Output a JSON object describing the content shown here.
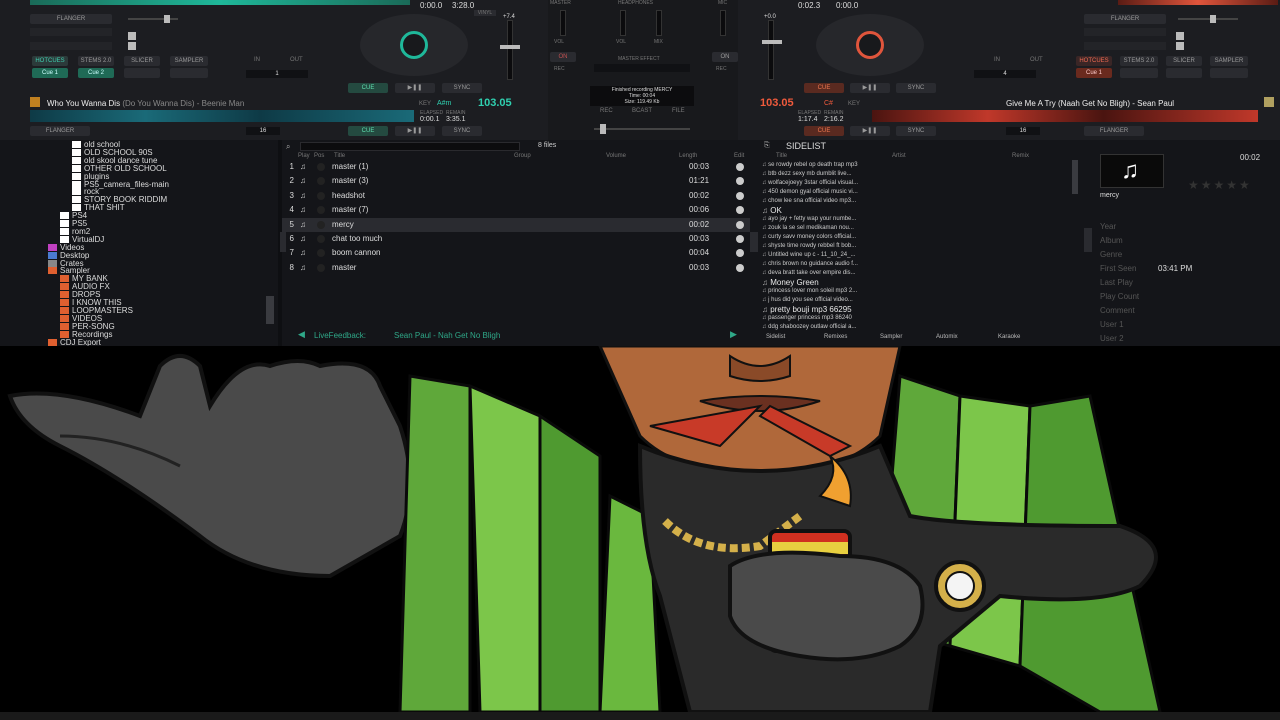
{
  "deck_left": {
    "time_elapsed": "0:00.0",
    "time_remain": "3:28.0",
    "pitch_val": "+7.4",
    "effect": "FLANGER",
    "pad_tabs": [
      "HOTCUES",
      "STEMS 2.0",
      "SLICER",
      "SAMPLER"
    ],
    "cue_labels": [
      "Cue 1",
      "Cue 2"
    ],
    "loop_in": "IN",
    "loop_out": "OUT",
    "loop_size": "1",
    "cue": "CUE",
    "play": "▶❚❚",
    "sync": "SYNC",
    "title": "Who You Wanna Dis",
    "title_sub": "(Do You Wanna Dis) - Beenie Man",
    "key_label": "KEY",
    "key": "A#m",
    "bpm": "103.05",
    "elapsed_label": "ELAPSED",
    "remain_label": "REMAIN",
    "elapsed": "0:00.1",
    "remain": "3:35.1",
    "bottom_effect": "FLANGER",
    "bottom_loop": "16"
  },
  "deck_right": {
    "time_elapsed": "0:02.3",
    "time_remain": "0:00.0",
    "pitch_val": "+0.0",
    "effect": "FLANGER",
    "pad_tabs": [
      "HOTCUES",
      "STEMS 2.0",
      "SLICER",
      "SAMPLER"
    ],
    "cue_labels": [
      "Cue 1"
    ],
    "loop_in": "IN",
    "loop_out": "OUT",
    "loop_size": "4",
    "cue": "CUE",
    "play": "▶❚❚",
    "sync": "SYNC",
    "title": "Give Me A Try (Naah Get No Bligh) - Sean Paul",
    "key_label": "KEY",
    "key": "C#",
    "bpm": "103.05",
    "elapsed_label": "ELAPSED",
    "remain_label": "REMAIN",
    "elapsed": "1:17.4",
    "remain": "2:16.2",
    "bottom_effect": "FLANGER",
    "bottom_loop": "16"
  },
  "mixer": {
    "master": "MASTER",
    "headphones": "HEADPHONES",
    "mic": "MIC",
    "vol": "VOL",
    "mix": "MIX",
    "on": "ON",
    "rec": "REC",
    "master_effect": "MASTER EFFECT",
    "recording_msg": "Finished recording MERCY",
    "rec_time": "Time: 00:04",
    "rec_size": "Size: 119.49 Kb",
    "rec_btn": "REC",
    "bcast_btn": "BCAST",
    "file_btn": "FILE"
  },
  "tree": [
    {
      "label": "old school",
      "indent": 3,
      "color": "#ffffff"
    },
    {
      "label": "OLD SCHOOL 90S",
      "indent": 3,
      "color": "#ffffff"
    },
    {
      "label": "old skool dance tune",
      "indent": 3,
      "color": "#ffffff"
    },
    {
      "label": "OTHER OLD SCHOOL",
      "indent": 3,
      "color": "#ffffff"
    },
    {
      "label": "plugins",
      "indent": 3,
      "color": "#ffffff"
    },
    {
      "label": "PS5_camera_files-main",
      "indent": 3,
      "color": "#ffffff"
    },
    {
      "label": "rock",
      "indent": 3,
      "color": "#ffffff"
    },
    {
      "label": "STORY BOOK RIDDIM",
      "indent": 3,
      "color": "#ffffff"
    },
    {
      "label": "THAT SHIT",
      "indent": 3,
      "color": "#ffffff"
    },
    {
      "label": "PS4",
      "indent": 2,
      "color": "#ffffff"
    },
    {
      "label": "PS5",
      "indent": 2,
      "color": "#ffffff"
    },
    {
      "label": "rom2",
      "indent": 2,
      "color": "#ffffff"
    },
    {
      "label": "VirtualDJ",
      "indent": 2,
      "color": "#ffffff"
    },
    {
      "label": "Videos",
      "indent": 1,
      "color": "#c040c0"
    },
    {
      "label": "Desktop",
      "indent": 1,
      "color": "#4a7ad0"
    },
    {
      "label": "Crates",
      "indent": 1,
      "color": "#888888"
    },
    {
      "label": "Sampler",
      "indent": 1,
      "color": "#e06030"
    },
    {
      "label": "MY BANK",
      "indent": 2,
      "color": "#e06030"
    },
    {
      "label": "AUDIO FX",
      "indent": 2,
      "color": "#e06030"
    },
    {
      "label": "DROPS",
      "indent": 2,
      "color": "#e06030"
    },
    {
      "label": "I KNOW THIS",
      "indent": 2,
      "color": "#e06030"
    },
    {
      "label": "LOOPMASTERS",
      "indent": 2,
      "color": "#e06030"
    },
    {
      "label": "VIDEOS",
      "indent": 2,
      "color": "#e06030"
    },
    {
      "label": "PER-SONG",
      "indent": 2,
      "color": "#e06030"
    },
    {
      "label": "Recordings",
      "indent": 2,
      "color": "#e06030"
    },
    {
      "label": "CDJ Export",
      "indent": 1,
      "color": "#e06030"
    }
  ],
  "list": {
    "count": "8 files",
    "headers": [
      "Play",
      "Pos",
      "Title",
      "Group",
      "Volume",
      "Length",
      "Edit"
    ],
    "rows": [
      {
        "num": "1",
        "title": "master (1)",
        "length": "00:03"
      },
      {
        "num": "2",
        "title": "master (3)",
        "length": "01:21"
      },
      {
        "num": "3",
        "title": "headshot",
        "length": "00:02"
      },
      {
        "num": "4",
        "title": "master (7)",
        "length": "00:06"
      },
      {
        "num": "5",
        "title": "mercy",
        "length": "00:02"
      },
      {
        "num": "6",
        "title": "chat too much",
        "length": "00:03"
      },
      {
        "num": "7",
        "title": "boom cannon",
        "length": "00:04"
      },
      {
        "num": "8",
        "title": "master",
        "length": "00:03"
      }
    ],
    "livefeedback": "LiveFeedback:",
    "livefeedback_song": "Sean Paul - Nah Get No Bligh"
  },
  "sidelist": {
    "title": "SIDELIST",
    "headers": [
      "Title",
      "Artist",
      "Remix"
    ],
    "rows": [
      {
        "t": "se rowdy rebel op death trap mp3",
        "big": false
      },
      {
        "t": "btb dezz sexy mb dumblit live...",
        "big": false
      },
      {
        "t": "wolfacejoeyy 3star official visual...",
        "big": false
      },
      {
        "t": "450 demon gyal official music vi...",
        "big": false
      },
      {
        "t": "chow lee sna official video mp3...",
        "big": false
      },
      {
        "t": "OK",
        "big": true
      },
      {
        "t": "ayo jay + fetty wap your numbe...",
        "big": false
      },
      {
        "t": "zouk la se sel medikaman nou...",
        "big": false
      },
      {
        "t": "curty savv money colors official...",
        "big": false
      },
      {
        "t": "shyste time rowdy rebbel ft bob...",
        "big": false
      },
      {
        "t": "Untitled  wine up c - 11_10_24_...",
        "big": false
      },
      {
        "t": "chris brown no guidance audio f...",
        "big": false
      },
      {
        "t": "deva bratt take over empire dis...",
        "big": false
      },
      {
        "t": "Money Green",
        "big": true
      },
      {
        "t": "princess lover mon soleil mp3 2...",
        "big": false
      },
      {
        "t": "j hus did you see official video...",
        "big": false
      },
      {
        "t": "pretty bouji mp3 66295",
        "big": true
      },
      {
        "t": "passenger princess mp3 86240",
        "big": false
      },
      {
        "t": "ddg shaboozey outlaw official a...",
        "big": false
      }
    ],
    "tabs": [
      "Sidelist",
      "Remixes",
      "Sampler",
      "Automix",
      "Karaoke"
    ]
  },
  "info": {
    "time": "00:02",
    "title": "mercy",
    "fields": [
      "Year",
      "Album",
      "Genre",
      "First Seen",
      "Last Play",
      "Play Count",
      "Comment",
      "User 1",
      "User 2"
    ],
    "first_seen": "03:41 PM"
  },
  "colors": {
    "deck_left_accent": "#1fb89a",
    "deck_right_accent": "#e0553c",
    "bpm_left": "#2fd0b0",
    "bpm_right": "#f05a3c",
    "livefeedback": "#2fa888"
  }
}
